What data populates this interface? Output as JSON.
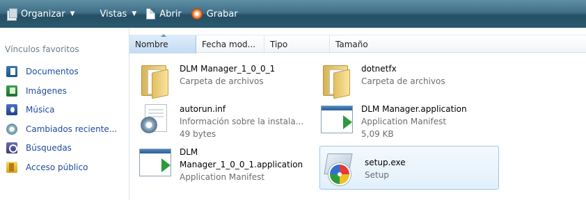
{
  "toolbar": {
    "organize_label": "Organizar",
    "views_label": "Vistas",
    "open_label": "Abrir",
    "burn_label": "Grabar"
  },
  "sidebar": {
    "title": "Vínculos favoritos",
    "items": [
      {
        "label": "Documentos",
        "icon": "documents-icon"
      },
      {
        "label": "Imágenes",
        "icon": "pictures-icon"
      },
      {
        "label": "Música",
        "icon": "music-icon"
      },
      {
        "label": "Cambiados reciente...",
        "icon": "recent-changed-icon"
      },
      {
        "label": "Búsquedas",
        "icon": "searches-icon"
      },
      {
        "label": "Acceso público",
        "icon": "public-icon"
      }
    ]
  },
  "columns": [
    {
      "label": "Nombre",
      "sorted": true
    },
    {
      "label": "Fecha mod..."
    },
    {
      "label": "Tipo"
    },
    {
      "label": "Tamaño"
    }
  ],
  "files": [
    {
      "name": "DLM Manager_1_0_0_1",
      "desc": "Carpeta de archivos",
      "icon": "folder-icon"
    },
    {
      "name": "dotnetfx",
      "desc": "Carpeta de archivos",
      "icon": "folder-icon"
    },
    {
      "name": "autorun.inf",
      "desc": "Información sobre la instala...",
      "size": "49 bytes",
      "icon": "setup-information-icon"
    },
    {
      "name": "DLM Manager.application",
      "desc": "Application Manifest",
      "size": "5,09 KB",
      "icon": "application-manifest-icon"
    },
    {
      "name_line1": "DLM",
      "name_line2": "Manager_1_0_0_1.application",
      "desc": "Application Manifest",
      "icon": "application-manifest-icon"
    },
    {
      "name": "setup.exe",
      "desc": "Setup",
      "icon": "setup-exe-icon",
      "selected": true
    }
  ],
  "colors": {
    "toolbar_top": "#5f8fa5",
    "toolbar_bottom": "#244f64",
    "link": "#1c4b9c",
    "secondary_text": "#6d6d6d",
    "selection_border": "#9fc6e6"
  }
}
